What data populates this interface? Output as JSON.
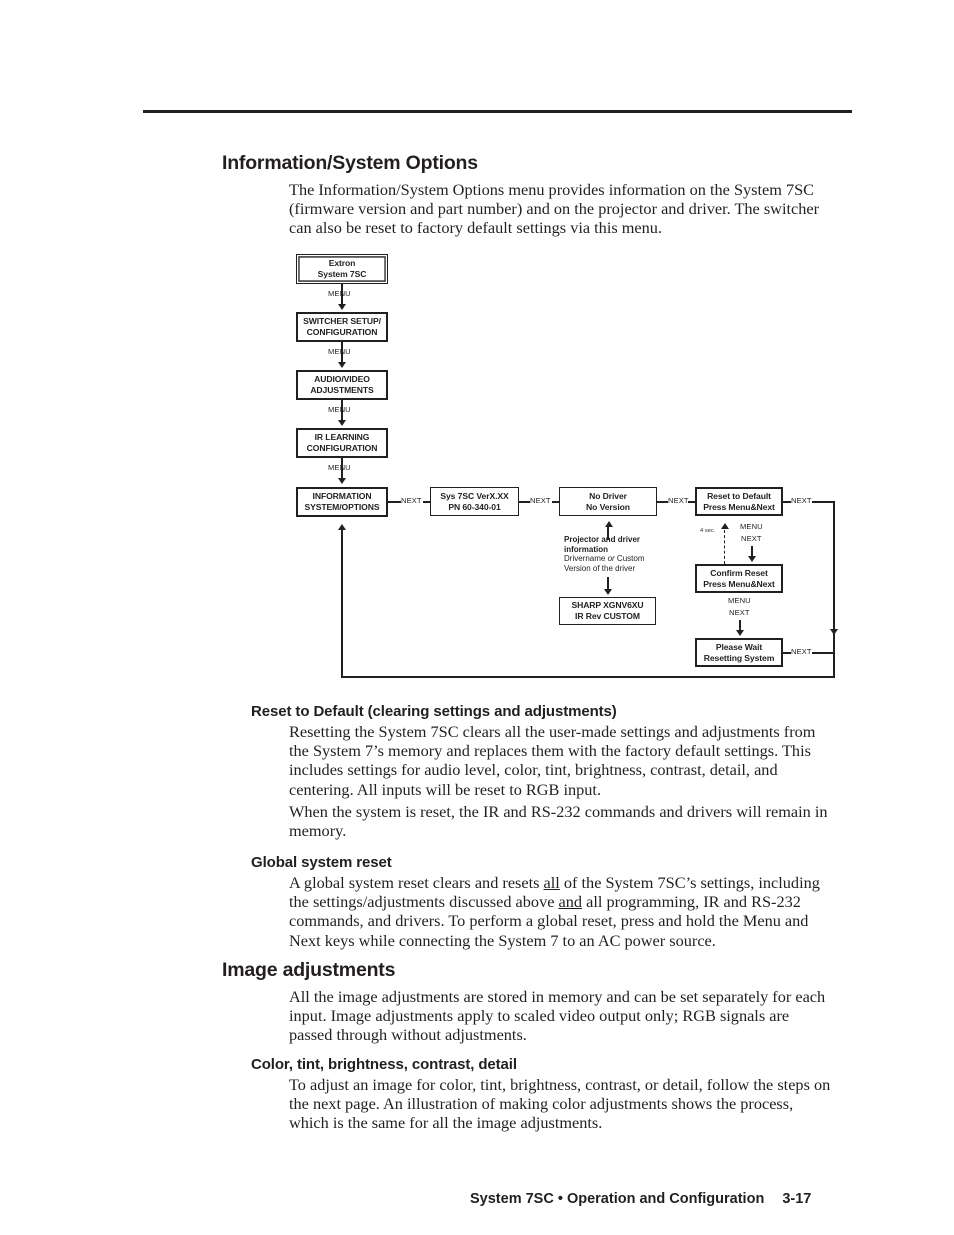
{
  "sections": {
    "info_system_options": {
      "heading": "Information/System Options",
      "paragraph": "The Information/System Options menu provides information on the System 7SC (firmware version and part number) and on the projector and driver.  The switcher can also be reset to factory default settings via this menu."
    },
    "reset_to_default": {
      "heading": "Reset to Default (clearing settings and adjustments)",
      "paragraph1": "Resetting the System 7SC clears all the user-made settings and adjustments from the System 7’s memory and replaces them with the factory default settings.  This includes settings for audio level, color, tint, brightness, contrast, detail, and centering.  All inputs will be reset to RGB input.",
      "paragraph2": "When the system is reset, the IR and RS-232 commands and drivers will remain in memory."
    },
    "global_system_reset": {
      "heading": "Global system reset",
      "paragraph_part1": "A global system reset clears and resets ",
      "paragraph_u1": "all",
      "paragraph_part2": " of the System 7SC’s settings, including the settings/adjustments discussed above ",
      "paragraph_u2": "and",
      "paragraph_part3": " all programming, IR and RS-232 commands, and drivers.  To perform a global reset, press and hold the Menu and Next keys while connecting the System 7 to an AC power source."
    },
    "image_adjustments": {
      "heading": "Image adjustments",
      "paragraph": "All the image adjustments are stored in memory and can be set separately for each input.  Image adjustments apply to scaled video output only; RGB signals are passed through without adjustments."
    },
    "color_tint": {
      "heading": "Color, tint, brightness, contrast, detail",
      "paragraph": "To adjust an image for color, tint, brightness, contrast, or detail, follow the steps on the next page.  An illustration of making color adjustments shows the process, which is the same for all the image adjustments."
    }
  },
  "footer": {
    "title": "System 7SC • Operation and Configuration",
    "page": "3-17"
  },
  "diagram": {
    "boxes": {
      "extron": {
        "line1": "Extron",
        "line2": "System 7SC"
      },
      "switcher_setup": {
        "line1": "SWITCHER SETUP/",
        "line2": "CONFIGURATION"
      },
      "audio_video": {
        "line1": "AUDIO/VIDEO",
        "line2": "ADJUSTMENTS"
      },
      "ir_learning": {
        "line1": "IR LEARNING",
        "line2": "CONFIGURATION"
      },
      "information": {
        "line1": "INFORMATION",
        "line2": "SYSTEM/OPTIONS"
      },
      "sys_version": {
        "line1": "Sys 7SC  VerX.XX",
        "line2": "PN 60-340-01"
      },
      "no_driver": {
        "line1": "No Driver",
        "line2": "No Version"
      },
      "reset_default": {
        "line1": "Reset to Default",
        "line2": "Press Menu&Next"
      },
      "confirm_reset": {
        "line1": "Confirm Reset",
        "line2": "Press Menu&Next"
      },
      "please_wait": {
        "line1": "Please Wait",
        "line2": "Resetting System"
      },
      "sharp": {
        "line1": "SHARP    XGNV6XU",
        "line2": "IR  Rev  CUSTOM"
      }
    },
    "labels": {
      "menu1": "MENU",
      "menu2": "MENU",
      "menu3": "MENU",
      "menu4": "MENU",
      "next1": "NEXT",
      "next2": "NEXT",
      "next3": "NEXT",
      "next4": "NEXT",
      "next5": "NEXT",
      "menu_a": "MENU",
      "next_a": "NEXT",
      "menu_b": "MENU",
      "next_b": "NEXT",
      "four_sec": "4 sec."
    },
    "annotation": {
      "title_line1": "Projector and driver",
      "title_line2": "information",
      "sub_line1_a": "Drivername ",
      "sub_line1_i": "or",
      "sub_line1_b": " Custom",
      "sub_line2": "Version of the driver"
    }
  }
}
